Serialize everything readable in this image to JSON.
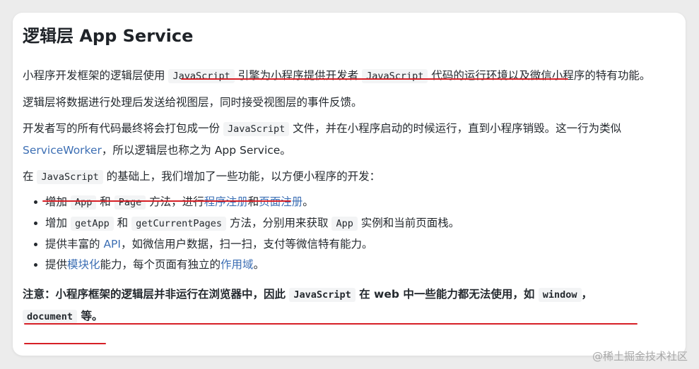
{
  "title": "逻辑层 App Service",
  "p1": {
    "t1": "小程序开发框架的逻辑层使用",
    "c1": "JavaScript",
    "t2": "引擎为小程序提供开发者",
    "c2": "JavaScript",
    "t3": "代码的运行环境以及微信小程序的特有功能。"
  },
  "p2": "逻辑层将数据进行处理后发送给视图层，同时接受视图层的事件反馈。",
  "p3": {
    "t1": "开发者写的所有代码最终将会打包成一份",
    "c1": "JavaScript",
    "t2": "文件，并在小程序启动的时候运行，直到小程序销毁。这一行为类似",
    "link": "ServiceWorker",
    "t3": "，所以逻辑层也称之为 App Service。"
  },
  "p4": {
    "t1": "在",
    "c1": "JavaScript",
    "t2": "的基础上，我们增加了一些功能，以方便小程序的开发："
  },
  "list": {
    "i1": {
      "t1": "增加",
      "c1": "App",
      "t2": "和",
      "c2": "Page",
      "t3": "方法，进行",
      "l1": "程序注册",
      "t4": "和",
      "l2": "页面注册",
      "t5": "。"
    },
    "i2": {
      "t1": "增加",
      "c1": "getApp",
      "t2": "和",
      "c2": "getCurrentPages",
      "t3": "方法，分别用来获取",
      "c3": "App",
      "t4": "实例和当前页面栈。"
    },
    "i3": {
      "t1": "提供丰富的",
      "l1": "API",
      "t2": "，如微信用户数据，扫一扫，支付等微信特有能力。"
    },
    "i4": {
      "t1": "提供",
      "l1": "模块化",
      "t2": "能力，每个页面有独立的",
      "l2": "作用域",
      "t3": "。"
    }
  },
  "note": {
    "t1": "注意：小程序框架的逻辑层并非运行在浏览器中，因此",
    "c1": "JavaScript",
    "t2": "在 web 中一些能力都无法使用，如",
    "c2": "window",
    "t3": "，",
    "c3": "document",
    "t4": "等。"
  },
  "watermark": "@稀土掘金技术社区",
  "colors": {
    "link": "#3d6fb4",
    "underline": "#d61f26",
    "code_bg": "#f3f4f5"
  }
}
